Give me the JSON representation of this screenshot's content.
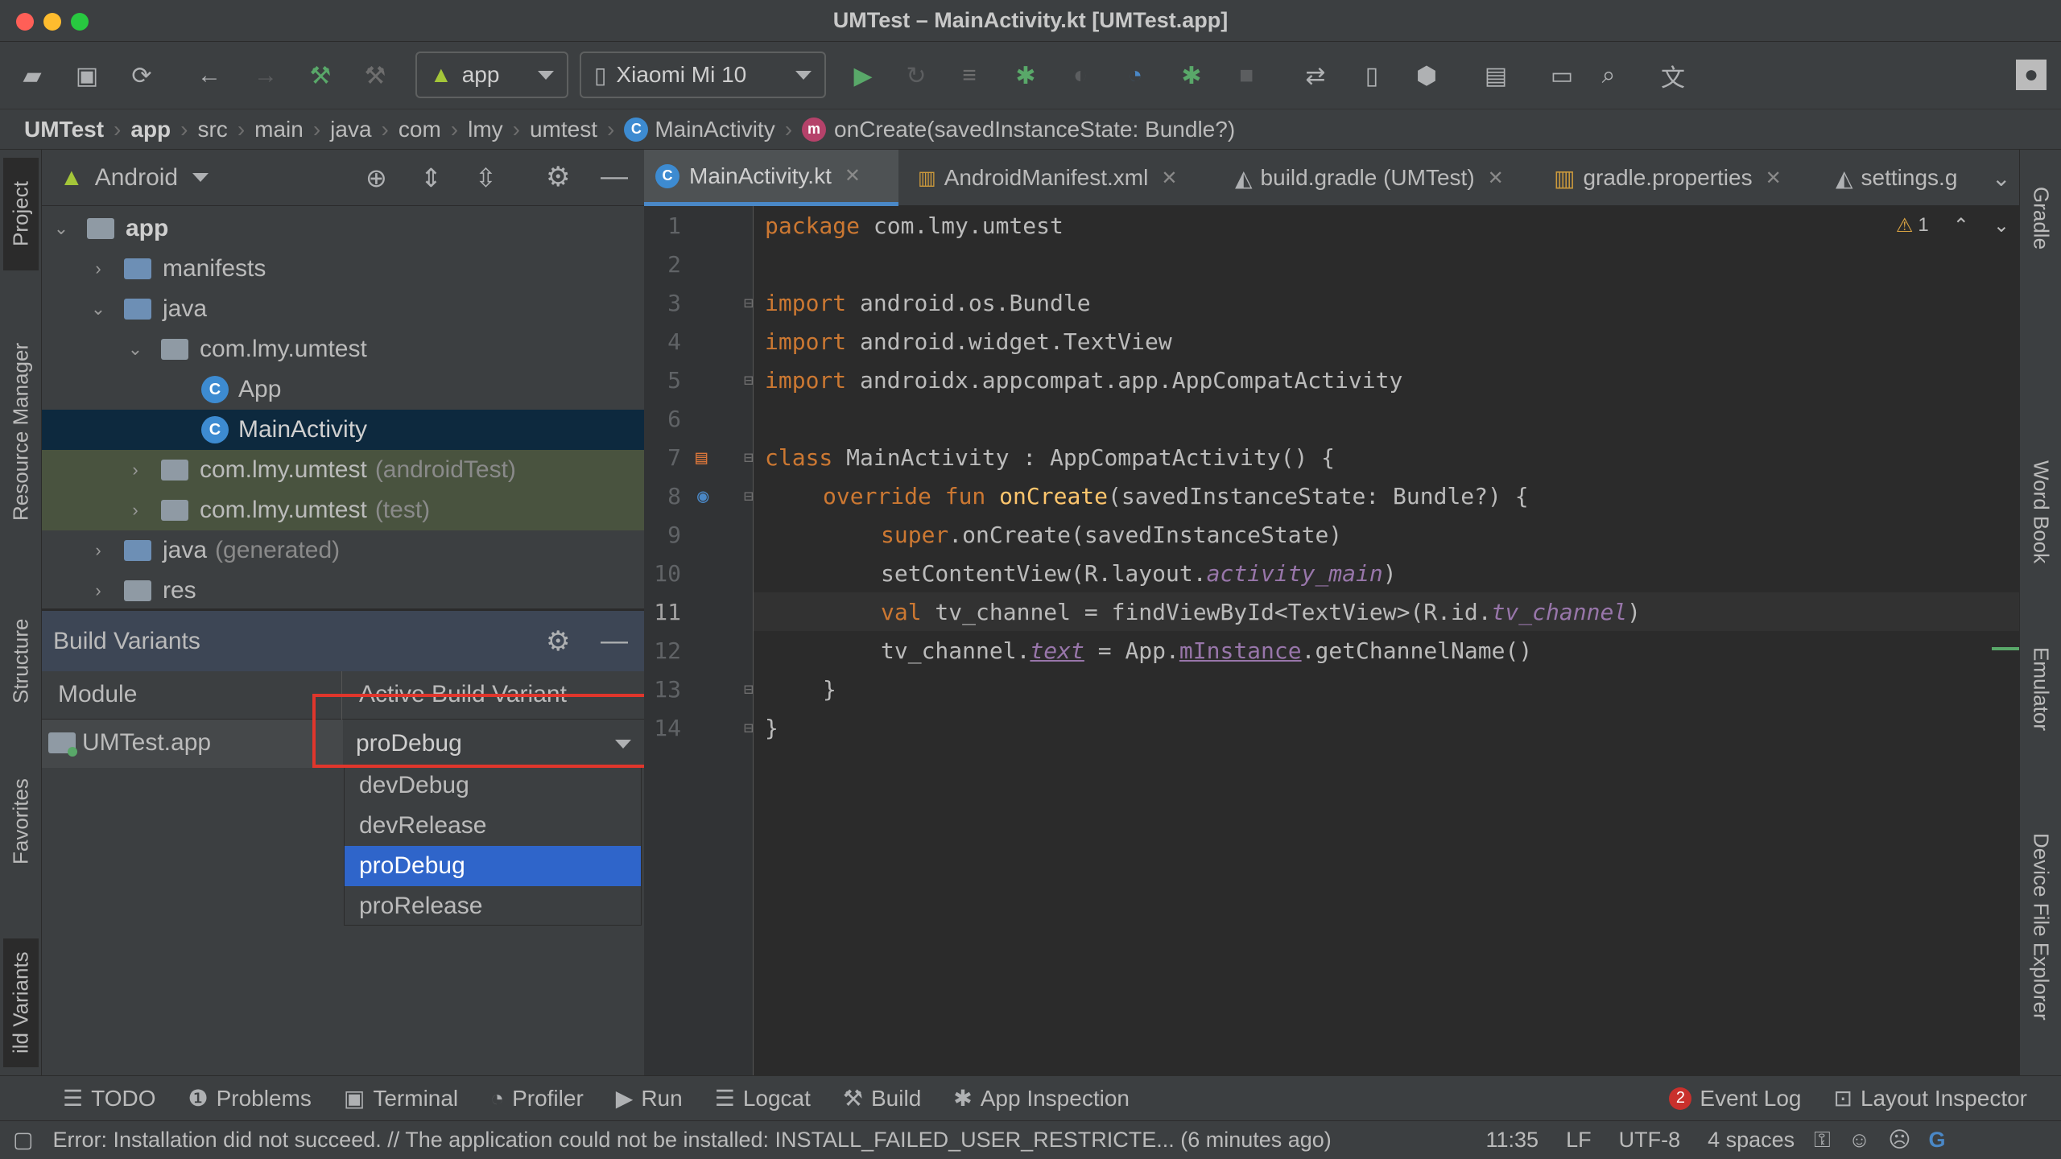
{
  "window": {
    "title": "UMTest – MainActivity.kt [UMTest.app]"
  },
  "toolbar": {
    "run_config": "app",
    "device": "Xiaomi Mi 10"
  },
  "breadcrumb": [
    "UMTest",
    "app",
    "src",
    "main",
    "java",
    "com",
    "lmy",
    "umtest",
    "MainActivity",
    "onCreate(savedInstanceState: Bundle?)"
  ],
  "left_strip": [
    "Project",
    "Resource Manager",
    "Structure",
    "Favorites",
    "ild Variants"
  ],
  "right_strip": [
    "Gradle",
    "Word Book",
    "Emulator",
    "Device File Explorer"
  ],
  "project": {
    "view": "Android",
    "tree": [
      {
        "label": "app",
        "suffix": ""
      },
      {
        "label": "manifests",
        "suffix": ""
      },
      {
        "label": "java",
        "suffix": ""
      },
      {
        "label": "com.lmy.umtest",
        "suffix": ""
      },
      {
        "label": "App",
        "suffix": ""
      },
      {
        "label": "MainActivity",
        "suffix": ""
      },
      {
        "label": "com.lmy.umtest",
        "suffix": "(androidTest)"
      },
      {
        "label": "com.lmy.umtest",
        "suffix": "(test)"
      },
      {
        "label": "java",
        "suffix": "(generated)"
      },
      {
        "label": "res",
        "suffix": ""
      }
    ]
  },
  "build_variants": {
    "title": "Build Variants",
    "col_module": "Module",
    "col_variant": "Active Build Variant",
    "module": "UMTest.app",
    "selected": "proDebug",
    "options": [
      "devDebug",
      "devRelease",
      "proDebug",
      "proRelease"
    ]
  },
  "editor_tabs": [
    "MainActivity.kt",
    "AndroidManifest.xml",
    "build.gradle (UMTest)",
    "gradle.properties",
    "settings.g"
  ],
  "editor": {
    "warnings": "1",
    "lines": [
      {
        "n": "1"
      },
      {
        "n": "2"
      },
      {
        "n": "3"
      },
      {
        "n": "4"
      },
      {
        "n": "5"
      },
      {
        "n": "6"
      },
      {
        "n": "7"
      },
      {
        "n": "8"
      },
      {
        "n": "9"
      },
      {
        "n": "10"
      },
      {
        "n": "11"
      },
      {
        "n": "12"
      },
      {
        "n": "13"
      },
      {
        "n": "14"
      }
    ],
    "code": {
      "l1_kw": "package",
      "l1_rest": " com.lmy.umtest",
      "l3_kw": "import",
      "l3_rest": " android.os.Bundle",
      "l4_kw": "import",
      "l4_rest": " android.widget.TextView",
      "l5_kw": "import",
      "l5_rest": " androidx.appcompat.app.AppCompatActivity",
      "l7_kw": "class",
      "l7_rest": " MainActivity : AppCompatActivity() {",
      "l8_kw": "override fun",
      "l8_fn": "onCreate",
      "l8_rest": "(savedInstanceState: Bundle?) {",
      "l9_kw": "super",
      "l9_rest": ".onCreate(savedInstanceState)",
      "l10_a": "setContentView(R.layout.",
      "l10_it": "activity_main",
      "l10_b": ")",
      "l11_kw": "val",
      "l11_a": " tv_channel = findViewById<TextView>(R.id.",
      "l11_it": "tv_channel",
      "l11_b": ")",
      "l12_a": "tv_channel.",
      "l12_ul": "text",
      "l12_b": " = App.",
      "l12_ul2": "mInstance",
      "l12_c": ".getChannelName()",
      "l13": "}",
      "l14": "}"
    }
  },
  "bottom_tools": [
    "TODO",
    "Problems",
    "Terminal",
    "Profiler",
    "Run",
    "Logcat",
    "Build",
    "App Inspection"
  ],
  "bottom_right": {
    "event_log": "Event Log",
    "event_count": "2",
    "layout_inspector": "Layout Inspector"
  },
  "status": {
    "message": "Error: Installation did not succeed. // The application could not be installed: INSTALL_FAILED_USER_RESTRICTE... (6 minutes ago)",
    "position": "11:35",
    "line_sep": "LF",
    "encoding": "UTF-8",
    "indent": "4 spaces"
  },
  "colors": {
    "accent": "#2f65ca",
    "highlight_box": "#e0362c",
    "run_green": "#59a869"
  }
}
